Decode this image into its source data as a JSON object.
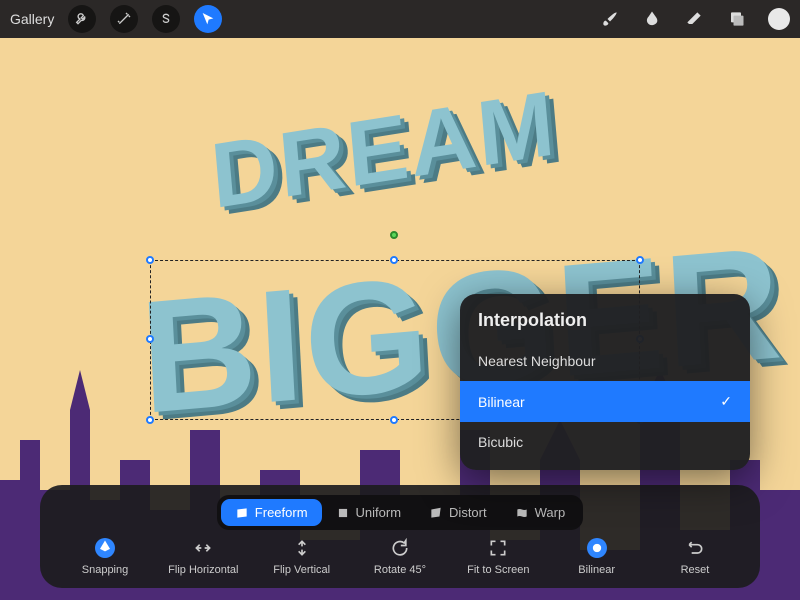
{
  "topbar": {
    "gallery": "Gallery"
  },
  "canvas_text": {
    "line1": "DREAM",
    "line2": "BIGGER"
  },
  "transform_modes": {
    "freeform": "Freeform",
    "uniform": "Uniform",
    "distort": "Distort",
    "warp": "Warp"
  },
  "actions": {
    "snapping": "Snapping",
    "flip_h": "Flip Horizontal",
    "flip_v": "Flip Vertical",
    "rotate": "Rotate 45°",
    "fit": "Fit to Screen",
    "interp": "Bilinear",
    "reset": "Reset"
  },
  "popover": {
    "title": "Interpolation",
    "options": {
      "nearest": "Nearest Neighbour",
      "bilinear": "Bilinear",
      "bicubic": "Bicubic"
    },
    "selected": "bilinear"
  },
  "colors": {
    "accent": "#1f7aff",
    "bg": "#f4d598",
    "skyline": "#4c2a75",
    "text3d": "#8dc3cf"
  }
}
